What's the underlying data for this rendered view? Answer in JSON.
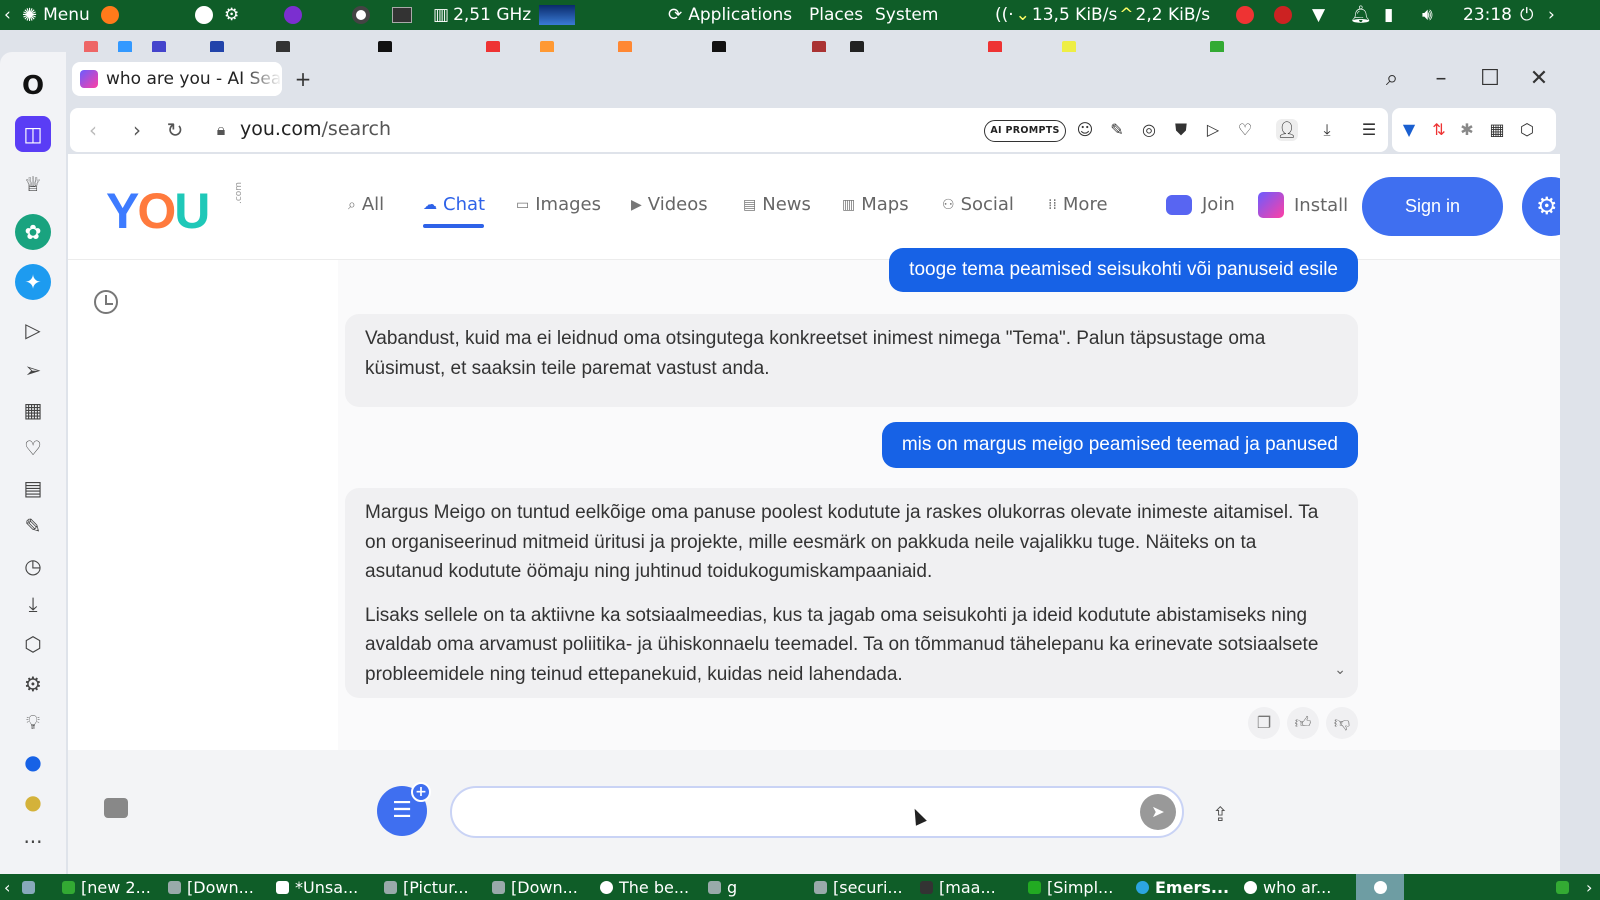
{
  "system_panel": {
    "menu_label": "Menu",
    "cpu_freq": "2,51 GHz",
    "applications_label": "Applications",
    "places_label": "Places",
    "system_label": "System",
    "net_down": "13,5 KiB/s",
    "net_up": "2,2 KiB/s",
    "clock": "23:18"
  },
  "browser": {
    "tab_title": "who are you - AI Search",
    "url_host": "you.com",
    "url_path": "/search",
    "ai_prompts_label": "AI PROMPTS"
  },
  "site": {
    "logo": {
      "y": "Y",
      "o": "O",
      "u": "U",
      "com": ".com"
    },
    "nav": [
      {
        "label": "All",
        "icon": "search-icon"
      },
      {
        "label": "Chat",
        "icon": "chat-bubble-icon"
      },
      {
        "label": "Images",
        "icon": "image-icon"
      },
      {
        "label": "Videos",
        "icon": "play-icon"
      },
      {
        "label": "News",
        "icon": "newspaper-icon"
      },
      {
        "label": "Maps",
        "icon": "map-icon"
      },
      {
        "label": "Social",
        "icon": "people-icon"
      },
      {
        "label": "More",
        "icon": "grid-dots-icon"
      }
    ],
    "join_label": "Join",
    "install_label": "Install",
    "signin_label": "Sign in"
  },
  "chat": {
    "messages": [
      {
        "role": "user",
        "text": "tooge tema peamised seisukohti või panuseid esile"
      },
      {
        "role": "bot",
        "paragraphs": [
          "Vabandust, kuid ma ei leidnud oma otsingutega konkreetset inimest nimega \"Tema\". Palun täpsustage oma küsimust, et saaksin teile paremat vastust anda."
        ]
      },
      {
        "role": "user",
        "text": "mis on margus meigo peamised teemad ja panused"
      },
      {
        "role": "bot",
        "paragraphs": [
          "Margus Meigo on tuntud eelkõige oma panuse poolest kodutute ja raskes olukorras olevate inimeste aitamisel. Ta on organiseerinud mitmeid üritusi ja projekte, mille eesmärk on pakkuda neile vajalikku tuge. Näiteks on ta asutanud kodutute öömaju ning juhtinud toidukogumiskampaaniaid.",
          "Lisaks sellele on ta aktiivne ka sotsiaalmeedias, kus ta jagab oma seisukohti ja ideid kodutute abistamiseks ning avaldab oma arvamust poliitika- ja ühiskonnaelu teemadel. Ta on tõmmanud tähelepanu ka erinevate sotsiaalsete probleemidele ning teinud ettepanekuid, kuidas neid lahendada."
        ]
      }
    ],
    "input_value": "",
    "input_placeholder": ""
  },
  "taskbar": {
    "tasks": [
      {
        "label": "[new 2..."
      },
      {
        "label": "[Down..."
      },
      {
        "label": "*Unsa..."
      },
      {
        "label": "[Pictur..."
      },
      {
        "label": "[Down..."
      },
      {
        "label": "The be..."
      },
      {
        "label": "g"
      },
      {
        "label": "[securi..."
      },
      {
        "label": "[maa..."
      },
      {
        "label": "[Simpl..."
      },
      {
        "label": "Emers..."
      },
      {
        "label": "who ar..."
      }
    ]
  },
  "colors": {
    "panel_green": "#0f5d28",
    "accent_blue": "#3f6ff0",
    "user_bubble": "#1762e6",
    "bot_bubble": "#f0f0f2"
  }
}
